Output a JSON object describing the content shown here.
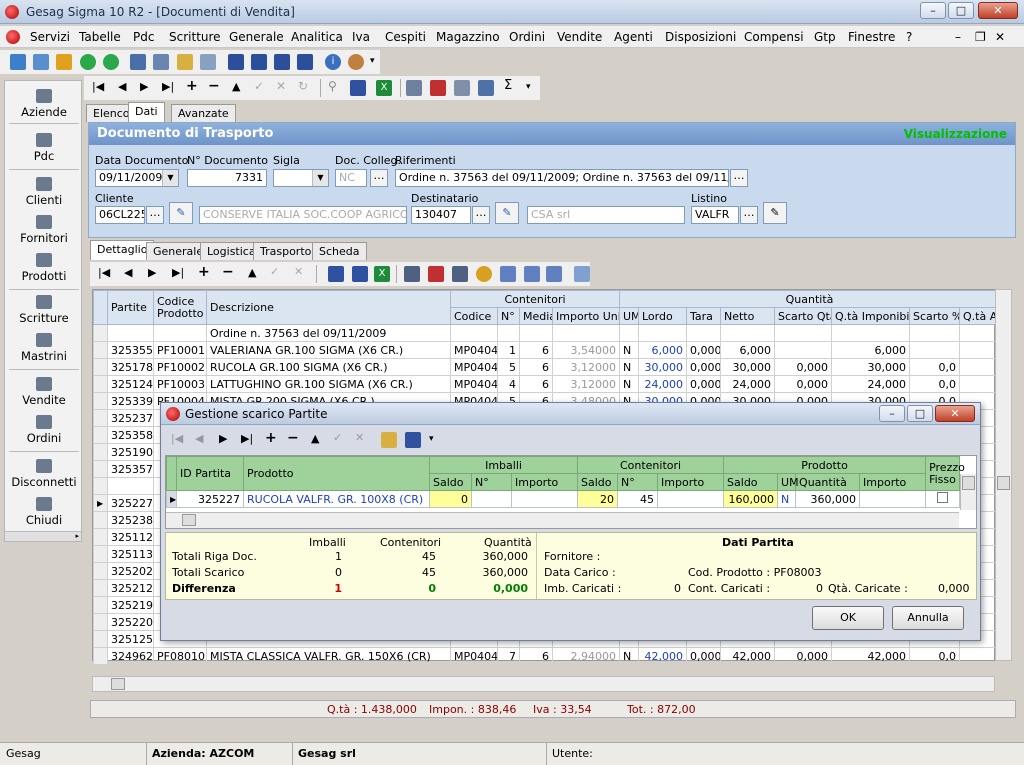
{
  "window": {
    "title": "Gesag Sigma 10 R2 - [Documenti di Vendita]"
  },
  "menu": [
    "Servizi",
    "Tabelle",
    "Pdc",
    "Scritture",
    "Generale",
    "Analitica",
    "Iva",
    "Cespiti",
    "Magazzino",
    "Ordini",
    "Vendite",
    "Agenti",
    "Disposizioni",
    "Compensi",
    "Gtp",
    "Finestre",
    "?"
  ],
  "sidebar": [
    "Aziende",
    "Pdc",
    "Clienti",
    "Fornitori",
    "Prodotti",
    "Scritture",
    "Mastrini",
    "Vendite",
    "Ordini",
    "Disconnetti",
    "Chiudi"
  ],
  "main_tabs": [
    "Elenco",
    "Dati",
    "Avanzate"
  ],
  "doc": {
    "title": "Documento di Trasporto",
    "mode": "Visualizzazione",
    "data_label": "Data Documento",
    "data": "09/11/2009",
    "num_label": "N° Documento",
    "num": "7331",
    "sigla_label": "Sigla",
    "sigla": "",
    "colleg_label": "Doc. Colleg.",
    "colleg": "NC",
    "rif_label": "Riferimenti",
    "rif": "Ordine n. 37563 del 09/11/2009; Ordine n. 37563 del 09/11/2009",
    "cliente_label": "Cliente",
    "cliente": "06CL225",
    "cliente_name": "CONSERVE ITALIA SOC.COOP AGRICOLA",
    "dest_label": "Destinatario",
    "dest": "130407",
    "dest_name": "CSA srl",
    "listino_label": "Listino",
    "listino": "VALFR"
  },
  "sub_tabs": [
    "Dettaglio",
    "Generale",
    "Logistica",
    "Trasporto",
    "Scheda"
  ],
  "grid": {
    "group_contenitori": "Contenitori",
    "group_quantita": "Quantità",
    "headers": [
      "Partite",
      "Codice Prodotto",
      "Descrizione",
      "Codice",
      "N°",
      "Media",
      "Importo Unit.",
      "UM",
      "Lordo",
      "Tara",
      "Netto",
      "Scarto Qtà",
      "Q.tà Imponibile",
      "Scarto %",
      "Q.tà A"
    ],
    "rows": [
      [
        "",
        "",
        "Ordine n. 37563 del 09/11/2009",
        "",
        "",
        "",
        "",
        "",
        "",
        "",
        "",
        "",
        "",
        "",
        ""
      ],
      [
        "325355",
        "PF10001",
        "VALERIANA GR.100 SIGMA (X6 CR.)",
        "MP04049",
        "1",
        "6",
        "3,54000",
        "N",
        "6,000",
        "0,000",
        "6,000",
        "",
        "6,000",
        "",
        ""
      ],
      [
        "325178",
        "PF10002",
        "RUCOLA GR.100 SIGMA (X6 CR.)",
        "MP04049",
        "5",
        "6",
        "3,12000",
        "N",
        "30,000",
        "0,000",
        "30,000",
        "0,000",
        "30,000",
        "0,0",
        ""
      ],
      [
        "325124",
        "PF10003",
        "LATTUGHINO GR.100 SIGMA (X6 CR.)",
        "MP04049",
        "4",
        "6",
        "3,12000",
        "N",
        "24,000",
        "0,000",
        "24,000",
        "0,000",
        "24,000",
        "0,0",
        ""
      ],
      [
        "325339",
        "PF10004",
        "MISTA GR.200 SIGMA (X6 CR.)",
        "MP04049",
        "5",
        "6",
        "3,48000",
        "N",
        "30,000",
        "0,000",
        "30,000",
        "0,000",
        "30,000",
        "0,0",
        ""
      ],
      [
        "325237",
        "",
        "",
        "",
        "",
        "",
        "",
        "",
        "",
        "",
        "",
        "",
        "",
        "",
        ""
      ],
      [
        "325358",
        "",
        "",
        "",
        "",
        "",
        "",
        "",
        "",
        "",
        "",
        "",
        "",
        "",
        ""
      ],
      [
        "325190",
        "",
        "",
        "",
        "",
        "",
        "",
        "",
        "",
        "",
        "",
        "",
        "",
        "",
        ""
      ],
      [
        "325357",
        "",
        "",
        "",
        "",
        "",
        "",
        "",
        "",
        "",
        "",
        "",
        "",
        "",
        ""
      ],
      [
        "",
        "",
        "",
        "",
        "",
        "",
        "",
        "",
        "",
        "",
        "",
        "",
        "",
        "",
        ""
      ],
      [
        "325227",
        "",
        "",
        "",
        "",
        "",
        "",
        "",
        "",
        "",
        "",
        "",
        "",
        "",
        ""
      ],
      [
        "325238",
        "",
        "",
        "",
        "",
        "",
        "",
        "",
        "",
        "",
        "",
        "",
        "",
        "",
        ""
      ],
      [
        "325112",
        "",
        "",
        "",
        "",
        "",
        "",
        "",
        "",
        "",
        "",
        "",
        "",
        "",
        ""
      ],
      [
        "325113",
        "",
        "",
        "",
        "",
        "",
        "",
        "",
        "",
        "",
        "",
        "",
        "",
        "",
        ""
      ],
      [
        "325202",
        "",
        "",
        "",
        "",
        "",
        "",
        "",
        "",
        "",
        "",
        "",
        "",
        "",
        ""
      ],
      [
        "325212",
        "",
        "",
        "",
        "",
        "",
        "",
        "",
        "",
        "",
        "",
        "",
        "",
        "",
        ""
      ],
      [
        "325219",
        "",
        "",
        "",
        "",
        "",
        "",
        "",
        "",
        "",
        "",
        "",
        "",
        "",
        ""
      ],
      [
        "325220",
        "",
        "",
        "",
        "",
        "",
        "",
        "",
        "",
        "",
        "",
        "",
        "",
        "",
        ""
      ],
      [
        "325125",
        "",
        "",
        "",
        "",
        "",
        "",
        "",
        "",
        "",
        "",
        "",
        "",
        "",
        ""
      ],
      [
        "324962",
        "PF08010",
        "MISTA CLASSICA VALFR. GR. 150X6 (CR)",
        "MP04049",
        "7",
        "6",
        "2,94000",
        "N",
        "42,000",
        "0,000",
        "42,000",
        "0,000",
        "42,000",
        "0,0",
        ""
      ]
    ]
  },
  "totals": {
    "qta": "Q.tà : 1.438,000",
    "impon": "Impon. : 838,46",
    "iva": "Iva : 33,54",
    "tot": "Tot. : 872,00"
  },
  "status": {
    "app": "Gesag",
    "azienda": "Azienda: AZCOM",
    "company": "Gesag srl",
    "utente": "Utente:"
  },
  "dialog": {
    "title": "Gestione scarico Partite",
    "groups": {
      "imballi": "Imballi",
      "contenitori": "Contenitori",
      "prodotto": "Prodotto",
      "prezzo": "Prezzo Fisso"
    },
    "headers": [
      "ID Partita",
      "Prodotto",
      "Saldo",
      "N°",
      "Importo",
      "Saldo",
      "N°",
      "Importo",
      "Saldo",
      "UM",
      "Quantità",
      "Importo"
    ],
    "row": {
      "id": "325227",
      "prodotto": "RUCOLA VALFR. GR. 100X8 (CR)",
      "imb_saldo": "0",
      "imb_n": "",
      "imb_imp": "",
      "cont_saldo": "20",
      "cont_n": "45",
      "cont_imp": "",
      "prod_saldo": "160,000",
      "um": "N",
      "qta": "360,000",
      "imp": ""
    },
    "summary": {
      "h_imballi": "Imballi",
      "h_contenitori": "Contenitori",
      "h_quantita": "Quantità",
      "rows": [
        {
          "label": "Totali Riga Doc.",
          "imb": "1",
          "cont": "45",
          "qta": "360,000"
        },
        {
          "label": "Totali Scarico",
          "imb": "0",
          "cont": "45",
          "qta": "360,000"
        },
        {
          "label": "Differenza",
          "imb": "1",
          "cont": "0",
          "qta": "0,000"
        }
      ]
    },
    "partita": {
      "title": "Dati Partita",
      "fornitore": "Fornitore :",
      "data_carico": "Data Carico :",
      "cod_prodotto": "Cod. Prodotto :  PF08003",
      "imb_caricati": "Imb. Caricati :",
      "imb_caricati_v": "0",
      "cont_caricati": "Cont. Caricati :",
      "cont_caricati_v": "0",
      "qta_caricate": "Qtà. Caricate :",
      "qta_caricate_v": "0,000"
    },
    "ok": "OK",
    "annulla": "Annulla"
  }
}
